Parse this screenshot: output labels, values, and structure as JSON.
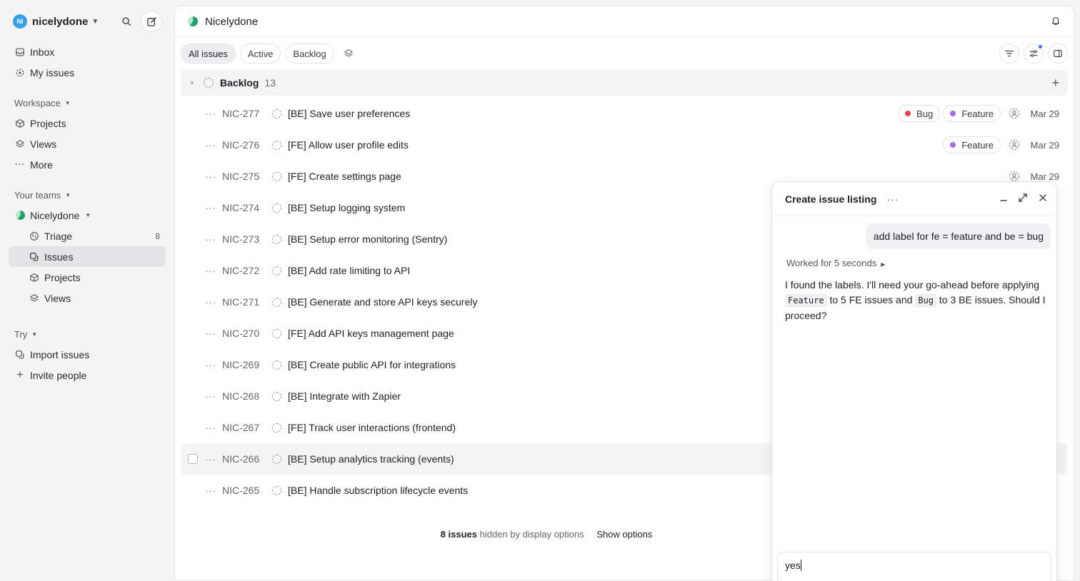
{
  "workspace": {
    "avatar": "NI",
    "name": "nicelydone"
  },
  "sidebar": {
    "top": [
      {
        "label": "Inbox",
        "icon": "inbox-icon"
      },
      {
        "label": "My issues",
        "icon": "target-icon"
      }
    ],
    "workspace_label": "Workspace",
    "workspace_items": [
      {
        "label": "Projects",
        "icon": "cube-icon"
      },
      {
        "label": "Views",
        "icon": "layers-icon"
      },
      {
        "label": "More",
        "icon": "ellipsis-icon"
      }
    ],
    "teams_label": "Your teams",
    "team_name": "Nicelydone",
    "team_items": [
      {
        "label": "Triage",
        "count": "8",
        "icon": "triage-icon"
      },
      {
        "label": "Issues",
        "icon": "issues-icon"
      },
      {
        "label": "Projects",
        "icon": "cube-icon"
      },
      {
        "label": "Views",
        "icon": "layers-icon"
      }
    ],
    "try_label": "Try",
    "try_items": [
      {
        "label": "Import issues",
        "icon": "import-icon"
      },
      {
        "label": "Invite people",
        "icon": "plus-icon"
      }
    ]
  },
  "header": {
    "title": "Nicelydone"
  },
  "tabs": [
    "All issues",
    "Active",
    "Backlog"
  ],
  "group": {
    "title": "Backlog",
    "count": "13"
  },
  "issues": [
    {
      "id": "NIC-277",
      "title": "[BE] Save user preferences",
      "labels": [
        "Bug",
        "Feature"
      ],
      "date": "Mar 29"
    },
    {
      "id": "NIC-276",
      "title": "[FE] Allow user profile edits",
      "labels": [
        "Feature"
      ],
      "date": "Mar 29"
    },
    {
      "id": "NIC-275",
      "title": "[FE] Create settings page",
      "labels": [],
      "date": "Mar 29"
    },
    {
      "id": "NIC-274",
      "title": "[BE] Setup logging system"
    },
    {
      "id": "NIC-273",
      "title": "[BE] Setup error monitoring (Sentry)"
    },
    {
      "id": "NIC-272",
      "title": "[BE] Add rate limiting to API"
    },
    {
      "id": "NIC-271",
      "title": "[BE] Generate and store API keys securely"
    },
    {
      "id": "NIC-270",
      "title": "[FE] Add API keys management page"
    },
    {
      "id": "NIC-269",
      "title": "[BE] Create public API for integrations"
    },
    {
      "id": "NIC-268",
      "title": "[BE] Integrate with Zapier"
    },
    {
      "id": "NIC-267",
      "title": "[FE] Track user interactions (frontend)"
    },
    {
      "id": "NIC-266",
      "title": "[BE] Setup analytics tracking (events)"
    },
    {
      "id": "NIC-265",
      "title": "[BE] Handle subscription lifecycle events"
    }
  ],
  "label_colors": {
    "Bug": "#e5484d",
    "Feature": "#a66be6"
  },
  "footer": {
    "count": "8 issues",
    "text": "hidden by display options",
    "action": "Show options"
  },
  "chat": {
    "title": "Create issue listing",
    "user_message": "add label for fe = feature and be = bug",
    "worked": "Worked for 5 seconds",
    "reply_a": "I found the labels. I'll need your go-ahead before applying ",
    "code_a": "Feature",
    "reply_b": " to 5 FE issues and ",
    "code_b": "Bug",
    "reply_c": " to 3 BE issues. Should I proceed?",
    "input_value": "yes"
  }
}
